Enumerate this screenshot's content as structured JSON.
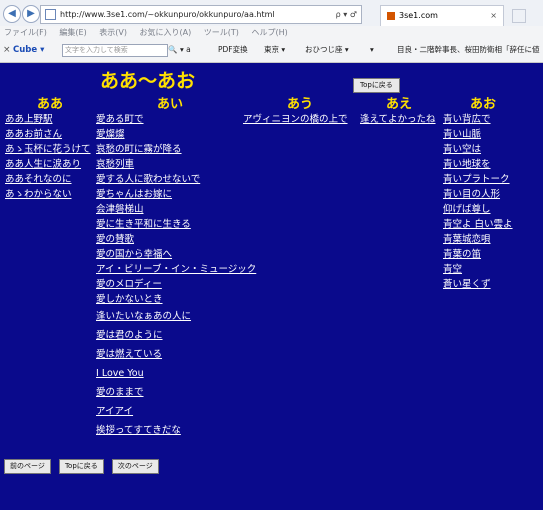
{
  "browser": {
    "url": "http://www.3se1.com/~okkunpuro/okkunpuro/aa.html",
    "url_controls": "ρ ▾ ♂",
    "tab_title": "3se1.com",
    "tab_close": "×",
    "menu": [
      "ファイル(F)",
      "編集(E)",
      "表示(V)",
      "お気に入り(A)",
      "ツール(T)",
      "ヘルプ(H)"
    ],
    "toolbar": {
      "close": "×",
      "cube_label": "Cube ▾",
      "search_placeholder": "文字を入力して検索",
      "items": [
        "▾ a",
        "PDF変換",
        "東京 ▾",
        "おひつじ座 ▾",
        "▾",
        "目良・二階幹事長、桜田防衛相「辞任に値"
      ]
    }
  },
  "page": {
    "title": "ああ～あお",
    "top_button": "Topに戻る",
    "columns": [
      {
        "heading": "ああ",
        "items": [
          "ああ上野駅",
          "ああお前さん",
          "あゝ玉杯に花うけて",
          "ああ人生に涙あり",
          "ああそれなのに",
          "あゝわからない"
        ]
      },
      {
        "heading": "あい",
        "items": [
          "愛ある町で",
          "愛燦燦",
          "哀愁の町に霧が降る",
          "哀愁列車",
          "愛する人に歌わせないで",
          "愛ちゃんはお嫁に",
          "会津磐梯山",
          "愛に生き平和に生きる",
          "愛の賛歌",
          "愛の国から幸福へ",
          "アイ・ビリーブ・イン・ミュージック",
          "愛のメロディー",
          "愛しかないとき",
          "逢いたいなぁあの人に",
          "愛は君のように",
          "愛は燃えている",
          "I Love You",
          "愛のままで",
          "アイアイ",
          "挨拶ってすてきだな"
        ]
      },
      {
        "heading": "あう",
        "items": [
          "アヴィニヨンの橋の上で"
        ]
      },
      {
        "heading": "あえ",
        "items": [
          "逢えてよかったね"
        ]
      },
      {
        "heading": "あお",
        "items": [
          "青い背広で",
          "青い山脈",
          "青い空は",
          "青い地球を",
          "青いプラトーク",
          "青い目の人形",
          "仰げば尊し",
          "青空よ 白い雲よ",
          "青葉城恋唄",
          "青葉の笛",
          "青空",
          "蒼い星くず"
        ]
      }
    ],
    "bottom_buttons": [
      "前のページ",
      "Topに戻る",
      "次のページ"
    ]
  }
}
